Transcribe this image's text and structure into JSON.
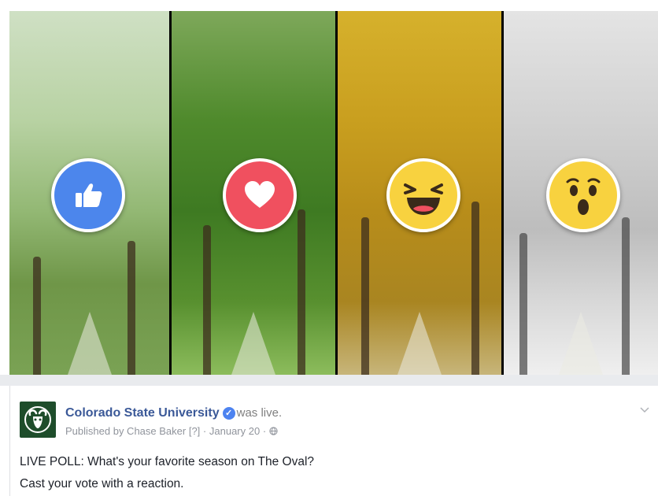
{
  "post": {
    "author": "Colorado State University",
    "verified_icon": "verified-check-icon",
    "status": "was live.",
    "published_by": "Published by Chase Baker",
    "help_marker": "[?]",
    "separator": "·",
    "date": "January 20",
    "audience_icon": "globe-icon",
    "line1": "LIVE POLL: What's your favorite season on The Oval?",
    "line2": "Cast your vote with a reaction."
  },
  "reactions": [
    {
      "name": "like",
      "icon": "thumbs-up-icon",
      "color": "#4c86ec",
      "season": "spring"
    },
    {
      "name": "love",
      "icon": "heart-icon",
      "color": "#f0505f",
      "season": "summer"
    },
    {
      "name": "haha",
      "icon": "laughing-face-icon",
      "color": "#f8d23f",
      "season": "fall"
    },
    {
      "name": "wow",
      "icon": "surprised-face-icon",
      "color": "#f8d23f",
      "season": "winter"
    }
  ],
  "colors": {
    "author_link": "#3b5998",
    "meta_text": "#90949c",
    "body_text": "#1d2129",
    "divider": "#e9ebee"
  }
}
